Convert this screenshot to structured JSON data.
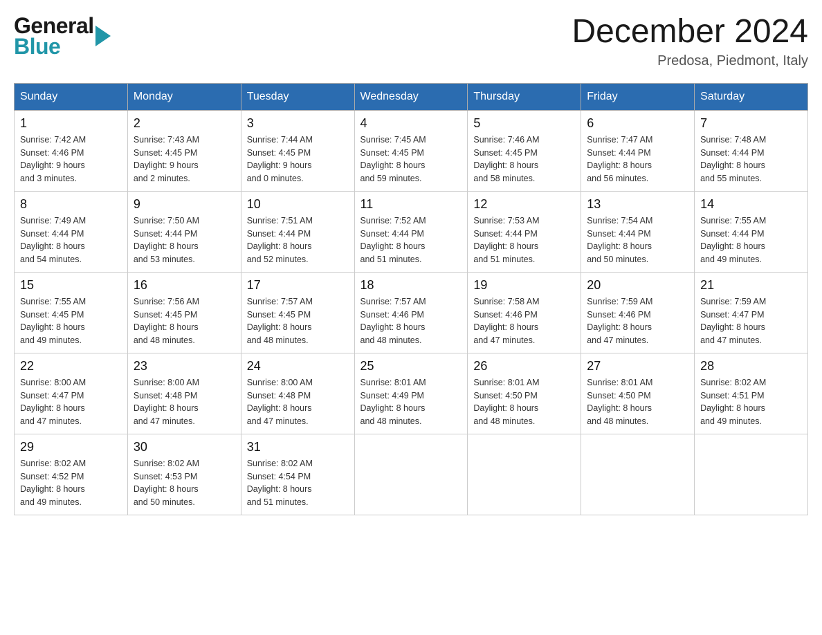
{
  "header": {
    "logo_general": "General",
    "logo_blue": "Blue",
    "month_title": "December 2024",
    "location": "Predosa, Piedmont, Italy"
  },
  "calendar": {
    "days_of_week": [
      "Sunday",
      "Monday",
      "Tuesday",
      "Wednesday",
      "Thursday",
      "Friday",
      "Saturday"
    ],
    "weeks": [
      [
        {
          "day": "1",
          "sunrise": "7:42 AM",
          "sunset": "4:46 PM",
          "daylight_hours": "9",
          "daylight_minutes": "3"
        },
        {
          "day": "2",
          "sunrise": "7:43 AM",
          "sunset": "4:45 PM",
          "daylight_hours": "9",
          "daylight_minutes": "2"
        },
        {
          "day": "3",
          "sunrise": "7:44 AM",
          "sunset": "4:45 PM",
          "daylight_hours": "9",
          "daylight_minutes": "0"
        },
        {
          "day": "4",
          "sunrise": "7:45 AM",
          "sunset": "4:45 PM",
          "daylight_hours": "8",
          "daylight_minutes": "59"
        },
        {
          "day": "5",
          "sunrise": "7:46 AM",
          "sunset": "4:45 PM",
          "daylight_hours": "8",
          "daylight_minutes": "58"
        },
        {
          "day": "6",
          "sunrise": "7:47 AM",
          "sunset": "4:44 PM",
          "daylight_hours": "8",
          "daylight_minutes": "56"
        },
        {
          "day": "7",
          "sunrise": "7:48 AM",
          "sunset": "4:44 PM",
          "daylight_hours": "8",
          "daylight_minutes": "55"
        }
      ],
      [
        {
          "day": "8",
          "sunrise": "7:49 AM",
          "sunset": "4:44 PM",
          "daylight_hours": "8",
          "daylight_minutes": "54"
        },
        {
          "day": "9",
          "sunrise": "7:50 AM",
          "sunset": "4:44 PM",
          "daylight_hours": "8",
          "daylight_minutes": "53"
        },
        {
          "day": "10",
          "sunrise": "7:51 AM",
          "sunset": "4:44 PM",
          "daylight_hours": "8",
          "daylight_minutes": "52"
        },
        {
          "day": "11",
          "sunrise": "7:52 AM",
          "sunset": "4:44 PM",
          "daylight_hours": "8",
          "daylight_minutes": "51"
        },
        {
          "day": "12",
          "sunrise": "7:53 AM",
          "sunset": "4:44 PM",
          "daylight_hours": "8",
          "daylight_minutes": "51"
        },
        {
          "day": "13",
          "sunrise": "7:54 AM",
          "sunset": "4:44 PM",
          "daylight_hours": "8",
          "daylight_minutes": "50"
        },
        {
          "day": "14",
          "sunrise": "7:55 AM",
          "sunset": "4:44 PM",
          "daylight_hours": "8",
          "daylight_minutes": "49"
        }
      ],
      [
        {
          "day": "15",
          "sunrise": "7:55 AM",
          "sunset": "4:45 PM",
          "daylight_hours": "8",
          "daylight_minutes": "49"
        },
        {
          "day": "16",
          "sunrise": "7:56 AM",
          "sunset": "4:45 PM",
          "daylight_hours": "8",
          "daylight_minutes": "48"
        },
        {
          "day": "17",
          "sunrise": "7:57 AM",
          "sunset": "4:45 PM",
          "daylight_hours": "8",
          "daylight_minutes": "48"
        },
        {
          "day": "18",
          "sunrise": "7:57 AM",
          "sunset": "4:46 PM",
          "daylight_hours": "8",
          "daylight_minutes": "48"
        },
        {
          "day": "19",
          "sunrise": "7:58 AM",
          "sunset": "4:46 PM",
          "daylight_hours": "8",
          "daylight_minutes": "47"
        },
        {
          "day": "20",
          "sunrise": "7:59 AM",
          "sunset": "4:46 PM",
          "daylight_hours": "8",
          "daylight_minutes": "47"
        },
        {
          "day": "21",
          "sunrise": "7:59 AM",
          "sunset": "4:47 PM",
          "daylight_hours": "8",
          "daylight_minutes": "47"
        }
      ],
      [
        {
          "day": "22",
          "sunrise": "8:00 AM",
          "sunset": "4:47 PM",
          "daylight_hours": "8",
          "daylight_minutes": "47"
        },
        {
          "day": "23",
          "sunrise": "8:00 AM",
          "sunset": "4:48 PM",
          "daylight_hours": "8",
          "daylight_minutes": "47"
        },
        {
          "day": "24",
          "sunrise": "8:00 AM",
          "sunset": "4:48 PM",
          "daylight_hours": "8",
          "daylight_minutes": "47"
        },
        {
          "day": "25",
          "sunrise": "8:01 AM",
          "sunset": "4:49 PM",
          "daylight_hours": "8",
          "daylight_minutes": "48"
        },
        {
          "day": "26",
          "sunrise": "8:01 AM",
          "sunset": "4:50 PM",
          "daylight_hours": "8",
          "daylight_minutes": "48"
        },
        {
          "day": "27",
          "sunrise": "8:01 AM",
          "sunset": "4:50 PM",
          "daylight_hours": "8",
          "daylight_minutes": "48"
        },
        {
          "day": "28",
          "sunrise": "8:02 AM",
          "sunset": "4:51 PM",
          "daylight_hours": "8",
          "daylight_minutes": "49"
        }
      ],
      [
        {
          "day": "29",
          "sunrise": "8:02 AM",
          "sunset": "4:52 PM",
          "daylight_hours": "8",
          "daylight_minutes": "49"
        },
        {
          "day": "30",
          "sunrise": "8:02 AM",
          "sunset": "4:53 PM",
          "daylight_hours": "8",
          "daylight_minutes": "50"
        },
        {
          "day": "31",
          "sunrise": "8:02 AM",
          "sunset": "4:54 PM",
          "daylight_hours": "8",
          "daylight_minutes": "51"
        },
        null,
        null,
        null,
        null
      ]
    ],
    "labels": {
      "sunrise": "Sunrise",
      "sunset": "Sunset",
      "daylight": "Daylight"
    }
  }
}
